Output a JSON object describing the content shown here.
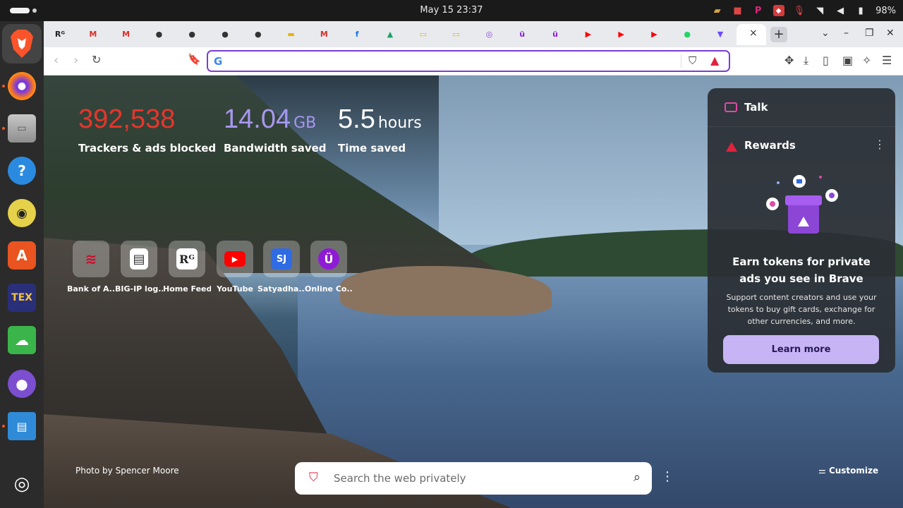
{
  "system_bar": {
    "clock": "May 15  23:37",
    "battery": "98%",
    "tray_icons": [
      "sketch-icon",
      "camera-icon",
      "p-icon",
      "screenshare-icon",
      "mic-muted-icon",
      "wifi-icon",
      "volume-icon",
      "battery-icon"
    ]
  },
  "dock": {
    "items": [
      "brave-browser",
      "firefox",
      "files",
      "help",
      "rhythmbox",
      "app-center",
      "texstudio",
      "remote-desktop",
      "github-desktop",
      "text-editor",
      "ubuntu-menu"
    ]
  },
  "browser": {
    "tabs": [
      {
        "icon": "researchgate",
        "glyph": "Rᴳ"
      },
      {
        "icon": "gmail",
        "glyph": "M"
      },
      {
        "icon": "gmail",
        "glyph": "M"
      },
      {
        "icon": "github",
        "glyph": "●"
      },
      {
        "icon": "github",
        "glyph": "●"
      },
      {
        "icon": "github",
        "glyph": "●"
      },
      {
        "icon": "github",
        "glyph": "●"
      },
      {
        "icon": "slides",
        "glyph": "▬"
      },
      {
        "icon": "gmail",
        "glyph": "M"
      },
      {
        "icon": "facebook",
        "glyph": "f"
      },
      {
        "icon": "drive",
        "glyph": "▲"
      },
      {
        "icon": "slides",
        "glyph": "▭"
      },
      {
        "icon": "slides",
        "glyph": "▭"
      },
      {
        "icon": "app",
        "glyph": "◎"
      },
      {
        "icon": "udemy",
        "glyph": "ü"
      },
      {
        "icon": "udemy",
        "glyph": "ü"
      },
      {
        "icon": "youtube",
        "glyph": "▶"
      },
      {
        "icon": "youtube",
        "glyph": "▶"
      },
      {
        "icon": "youtube",
        "glyph": "▶"
      },
      {
        "icon": "whatsapp",
        "glyph": "●"
      },
      {
        "icon": "proton",
        "glyph": "▼"
      }
    ],
    "active_tab_close": "×",
    "new_tab": "+",
    "url_value": "",
    "url_prefix_glyph": "G"
  },
  "ntp": {
    "stats": [
      {
        "value": "392,538",
        "unit": "",
        "label": "Trackers & ads blocked",
        "color": "#e8352b"
      },
      {
        "value": "14.04",
        "unit": "GB",
        "label": "Bandwidth saved",
        "color": "#a797f0"
      },
      {
        "value": "5.5",
        "unit": "hours",
        "label": "Time saved",
        "color": "#ffffff"
      }
    ],
    "top_sites": [
      {
        "name": "Bank of A...",
        "glyph": "≋",
        "color": "#c8102e"
      },
      {
        "name": "BIG-IP log...",
        "glyph": "▤",
        "color": "#ffffff"
      },
      {
        "name": "Home Feed...",
        "glyph": "Rᴳ",
        "color": "#ffffff"
      },
      {
        "name": "YouTube",
        "glyph": "▶",
        "color": "#ff0000"
      },
      {
        "name": "Satyadha...",
        "glyph": "SJ",
        "color": "#2f6be3"
      },
      {
        "name": "Online Co...",
        "glyph": "Ü",
        "color": "#8e1bd6"
      }
    ],
    "photo_credit": "Photo by Spencer Moore",
    "search_placeholder": "Search the web privately",
    "customize_label": "Customize"
  },
  "widgets": {
    "talk_label": "Talk",
    "rewards_label": "Rewards",
    "rewards_title": "Earn tokens for private ads you see in Brave",
    "rewards_desc": "Support content creators and use your tokens to buy gift cards, exchange for other currencies, and more.",
    "learn_more": "Learn more"
  }
}
